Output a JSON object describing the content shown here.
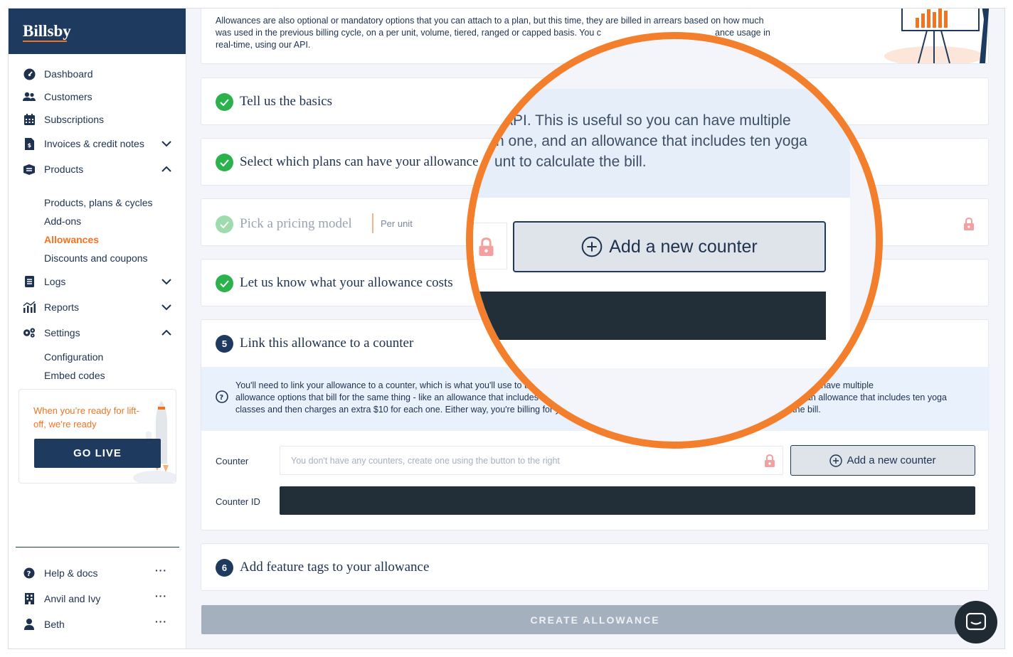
{
  "brand": {
    "name": "Billsby"
  },
  "nav": {
    "items": [
      {
        "label": "Dashboard",
        "icon": "dashboard-icon"
      },
      {
        "label": "Customers",
        "icon": "customers-icon"
      },
      {
        "label": "Subscriptions",
        "icon": "calendar-icon"
      },
      {
        "label": "Invoices & credit notes",
        "icon": "invoice-icon",
        "expandable": true,
        "expanded": false
      },
      {
        "label": "Products",
        "icon": "products-icon",
        "expandable": true,
        "expanded": true
      },
      {
        "label": "Logs",
        "icon": "logs-icon",
        "expandable": true,
        "expanded": false
      },
      {
        "label": "Reports",
        "icon": "reports-icon",
        "expandable": true,
        "expanded": false
      },
      {
        "label": "Settings",
        "icon": "settings-icon",
        "expandable": true,
        "expanded": true
      }
    ],
    "products_sub": [
      "Products, plans & cycles",
      "Add-ons",
      "Allowances",
      "Discounts and coupons"
    ],
    "products_active": "Allowances",
    "settings_sub": [
      "Configuration",
      "Embed codes"
    ]
  },
  "golive": {
    "text": "When you’re ready for lift-off, we’re ready",
    "button": "GO LIVE"
  },
  "footer": [
    {
      "label": "Help & docs",
      "icon": "help-icon"
    },
    {
      "label": "Anvil and Ivy",
      "icon": "building-icon"
    },
    {
      "label": "Beth",
      "icon": "user-icon"
    }
  ],
  "intro": {
    "line1": "Allowances are also optional or mandatory options that you can attach to a plan, but this time, they are billed in arrears based on how much",
    "line2_a": "was used in the previous billing cycle, on a per unit, volume, tiered, ranged or capped basis. You c",
    "line2_b": "ance usage in",
    "line3": "real-time, using our API."
  },
  "steps": {
    "s1": "Tell us the basics",
    "s2": "Select which plans can have your allowance",
    "s3": "Pick a pricing model",
    "s3_value": "Per unit",
    "s4": "Let us know what your allowance costs",
    "s5_num": "5",
    "s5": "Link this allowance to a counter",
    "s6_num": "6",
    "s6": "Add feature tags to your allowance"
  },
  "counter_info": {
    "line1": "You'll need to link your allowance to a counter, which is what you'll use to track allowance usage in real-time, using our API. This is useful so you can have multiple",
    "line2": "allowance options that bill for the same thing - like an allowance that includes five yoga classes and then charges an extra $15 for each one, and an allowance that includes ten yoga",
    "line3": "classes and then charges an extra $10 for each one. Either way, you're billing for yoga classes, so you can use the same counter to calculate the bill."
  },
  "counter_form": {
    "counter_label": "Counter",
    "counter_placeholder": "You don't have any counters, create one using the button to the right",
    "add_button": "Add a new counter",
    "counter_id_label": "Counter ID"
  },
  "magnifier": {
    "line1": "API. This is useful so you can have multiple",
    "line2": "h one, and an allowance that includes ten yoga",
    "line3": "unt to calculate the bill.",
    "add_button": "Add a new counter"
  },
  "create_button": "CREATE ALLOWANCE",
  "colors": {
    "brand": "#1e3a5f",
    "accent": "#f37321",
    "success": "#2bb24c",
    "magnifier_ring": "#f37f2c"
  }
}
